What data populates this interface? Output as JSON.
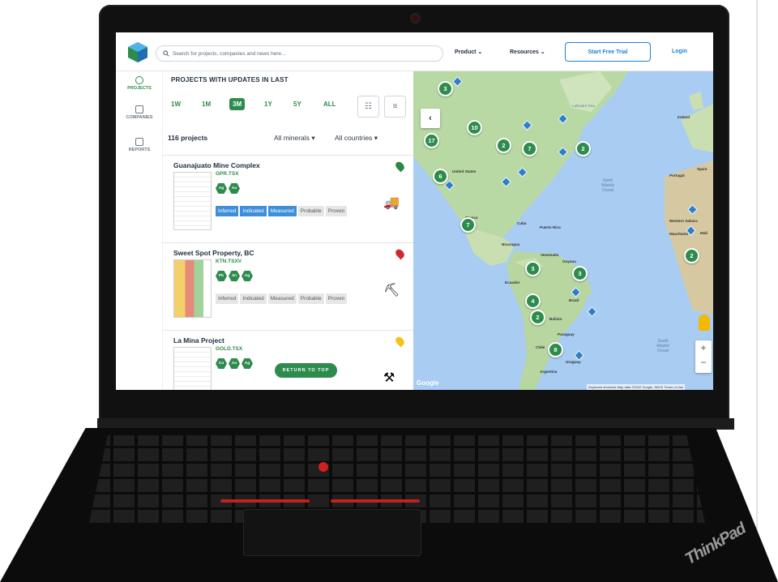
{
  "header": {
    "search_placeholder": "Search for projects, companies and news here...",
    "nav": [
      "Product",
      "Resources"
    ],
    "trial_label": "Start Free Trial",
    "login_label": "Login"
  },
  "sidebar": {
    "items": [
      {
        "label": "PROJECTS",
        "icon": "globe-icon"
      },
      {
        "label": "COMPANIES",
        "icon": "building-icon"
      },
      {
        "label": "REPORTS",
        "icon": "report-icon"
      }
    ]
  },
  "list": {
    "title": "PROJECTS WITH UPDATES IN LAST",
    "ranges": [
      "1W",
      "1M",
      "3M",
      "1Y",
      "5Y",
      "ALL"
    ],
    "active_range": "3M",
    "count": "116 projects",
    "filter_minerals": "All minerals",
    "filter_countries": "All countries",
    "projects": [
      {
        "name": "Guanajuato Mine Complex",
        "ticker": "GPR.TSX",
        "minerals": [
          "Ag",
          "Au"
        ],
        "flag_color": "#2a8a3f"
      },
      {
        "name": "Sweet Spot Property, BC",
        "ticker": "KTN.TSXV",
        "minerals": [
          "Pb",
          "Zn",
          "Ag"
        ],
        "flag_color": "#cf2a2a"
      },
      {
        "name": "La Mina Project",
        "ticker": "GOLD.TSX",
        "minerals": [
          "Cu",
          "Au",
          "Ag"
        ],
        "flag_color": "#f0c419"
      }
    ],
    "resource_levels": [
      "Inferred",
      "Indicated",
      "Measured",
      "Probable",
      "Proven"
    ],
    "return_to_top": "RETURN TO TOP"
  },
  "map": {
    "clusters": [
      "3",
      "10",
      "17",
      "2",
      "7",
      "2",
      "6",
      "7",
      "3",
      "3",
      "4",
      "2",
      "8",
      "2"
    ],
    "oceans": [
      "North\nAtlantic\nOcean",
      "South\nAtlantic\nOcean"
    ],
    "places": [
      "United States",
      "Cuba",
      "Puerto Rico",
      "Nicaragua",
      "Venezuela",
      "Guyana",
      "Ecuador",
      "Brazil",
      "Bolivia",
      "Paraguay",
      "Chile",
      "Uruguay",
      "Argentina",
      "Western Sahara",
      "Mauritania",
      "Mali",
      "Spain",
      "Portugal",
      "Ireland",
      "Labrador Sea",
      "Mexico"
    ],
    "google_label": "Google",
    "attribution": "Keyboard shortcuts   Map data ©2022 Google, INEGI   Terms of Use"
  },
  "device": {
    "brand": "ThinkPad"
  }
}
